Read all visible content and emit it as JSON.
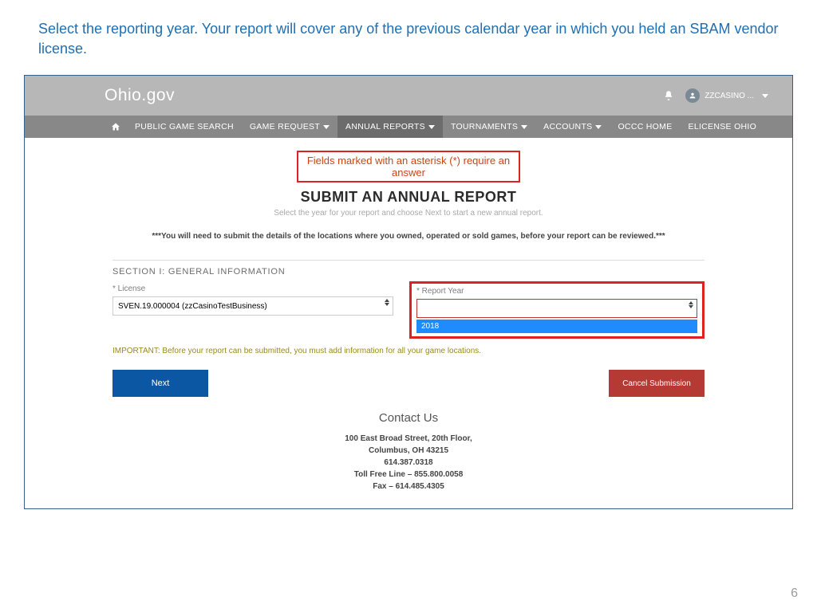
{
  "instruction": "Select the reporting year.  Your report will cover any of the previous calendar year in which you held an SBAM vendor license.",
  "brand": "Ohio.gov",
  "user_label": "ZZCASINO ...",
  "nav": {
    "items": [
      {
        "label": "PUBLIC GAME SEARCH",
        "dropdown": false
      },
      {
        "label": "GAME REQUEST",
        "dropdown": true
      },
      {
        "label": "ANNUAL REPORTS",
        "dropdown": true,
        "active": true
      },
      {
        "label": "TOURNAMENTS",
        "dropdown": true
      },
      {
        "label": "ACCOUNTS",
        "dropdown": true
      },
      {
        "label": "OCCC HOME",
        "dropdown": false
      },
      {
        "label": "ELICENSE OHIO",
        "dropdown": false
      }
    ]
  },
  "required_note": "Fields marked with an asterisk (*) require an answer",
  "title": "SUBMIT AN ANNUAL REPORT",
  "subtitle": "Select the year for your report and choose Next to start a new annual report.",
  "bold_note": "***You will need to submit the details of the locations where you owned, operated or sold games, before your report can be reviewed.***",
  "section_title": "SECTION I: GENERAL INFORMATION",
  "license": {
    "label": "* License",
    "value": "SVEN.19.000004 (zzCasinoTestBusiness)"
  },
  "report_year": {
    "label": "* Report Year",
    "value": "",
    "options": [
      "2018"
    ]
  },
  "important_note": "IMPORTANT: Before your report can be submitted, you must add information for all your game locations.",
  "buttons": {
    "next": "Next",
    "cancel": "Cancel Submission"
  },
  "contact": {
    "heading": "Contact Us",
    "line1": "100 East Broad Street, 20th Floor,",
    "line2": "Columbus, OH 43215",
    "line3": "614.387.0318",
    "line4": "Toll Free Line – 855.800.0058",
    "line5": "Fax – 614.485.4305"
  },
  "page_number": "6"
}
